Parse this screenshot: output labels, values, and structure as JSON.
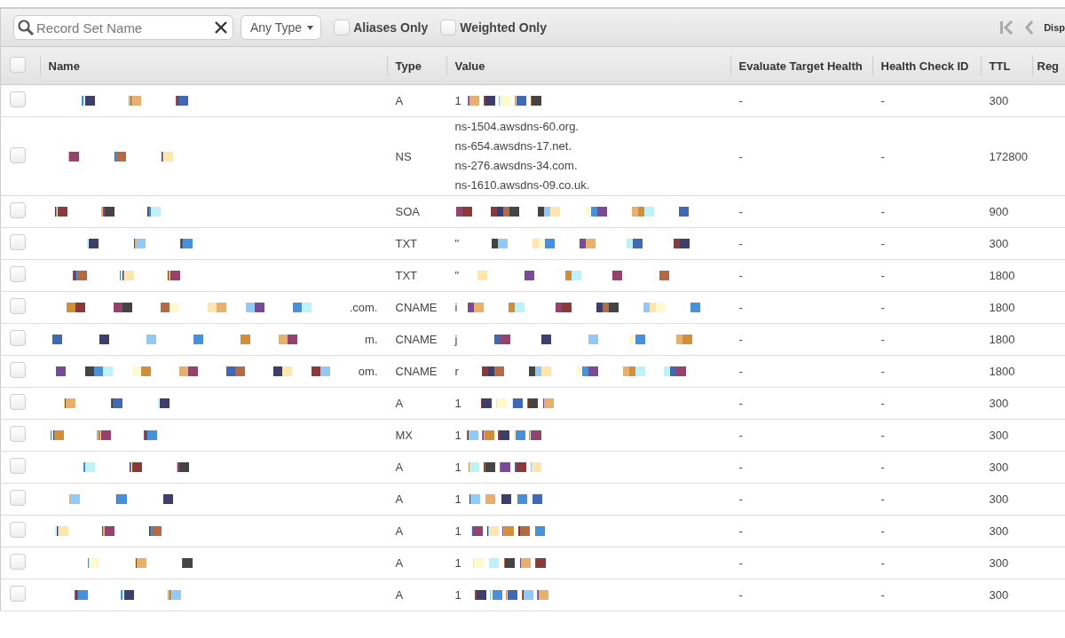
{
  "toolbar": {
    "search": {
      "placeholder": "Record Set Name"
    },
    "type_filter": {
      "value": "Any Type"
    },
    "filters": [
      {
        "label": "Aliases Only",
        "checked": false
      },
      {
        "label": "Weighted Only",
        "checked": false
      }
    ],
    "pager_text": "Disp"
  },
  "table": {
    "columns": [
      "Name",
      "Type",
      "Value",
      "Evaluate Target Health",
      "Health Check ID",
      "TTL",
      "Reg"
    ],
    "all_selected": false,
    "rows": [
      {
        "selected": false,
        "name_suffix": "",
        "type": "A",
        "values": [
          "1"
        ],
        "evaluate": "-",
        "health_check": "-",
        "ttl": "300"
      },
      {
        "selected": false,
        "name_suffix": "",
        "type": "NS",
        "values": [
          "ns-1504.awsdns-60.org.",
          "ns-654.awsdns-17.net.",
          "ns-276.awsdns-34.com.",
          "ns-1610.awsdns-09.co.uk."
        ],
        "evaluate": "-",
        "health_check": "-",
        "ttl": "172800"
      },
      {
        "selected": false,
        "name_suffix": "",
        "type": "SOA",
        "values": [],
        "evaluate": "-",
        "health_check": "-",
        "ttl": "900"
      },
      {
        "selected": false,
        "name_suffix": "",
        "type": "TXT",
        "values": [
          "\""
        ],
        "evaluate": "-",
        "health_check": "-",
        "ttl": "300"
      },
      {
        "selected": false,
        "name_suffix": "",
        "type": "TXT",
        "values": [
          "\""
        ],
        "evaluate": "-",
        "health_check": "-",
        "ttl": "1800"
      },
      {
        "selected": false,
        "name_suffix": ".com.",
        "type": "CNAME",
        "values": [
          "i"
        ],
        "evaluate": "-",
        "health_check": "-",
        "ttl": "1800"
      },
      {
        "selected": false,
        "name_suffix": "m.",
        "type": "CNAME",
        "values": [
          "j"
        ],
        "evaluate": "-",
        "health_check": "-",
        "ttl": "1800"
      },
      {
        "selected": false,
        "name_suffix": "om.",
        "type": "CNAME",
        "values": [
          "r"
        ],
        "evaluate": "-",
        "health_check": "-",
        "ttl": "1800"
      },
      {
        "selected": false,
        "name_suffix": "",
        "type": "A",
        "values": [
          "1"
        ],
        "evaluate": "-",
        "health_check": "-",
        "ttl": "300"
      },
      {
        "selected": false,
        "name_suffix": "",
        "type": "MX",
        "values": [
          "1"
        ],
        "evaluate": "-",
        "health_check": "-",
        "ttl": "300"
      },
      {
        "selected": false,
        "name_suffix": "",
        "type": "A",
        "values": [
          "1"
        ],
        "evaluate": "-",
        "health_check": "-",
        "ttl": "300"
      },
      {
        "selected": false,
        "name_suffix": "",
        "type": "A",
        "values": [
          "1"
        ],
        "evaluate": "-",
        "health_check": "-",
        "ttl": "300"
      },
      {
        "selected": false,
        "name_suffix": "",
        "type": "A",
        "values": [
          "1"
        ],
        "evaluate": "-",
        "health_check": "-",
        "ttl": "300"
      },
      {
        "selected": false,
        "name_suffix": "",
        "type": "A",
        "values": [
          "1"
        ],
        "evaluate": "-",
        "health_check": "-",
        "ttl": "300"
      },
      {
        "selected": false,
        "name_suffix": "",
        "type": "A",
        "values": [
          "1"
        ],
        "evaluate": "-",
        "health_check": "-",
        "ttl": "300"
      }
    ]
  }
}
